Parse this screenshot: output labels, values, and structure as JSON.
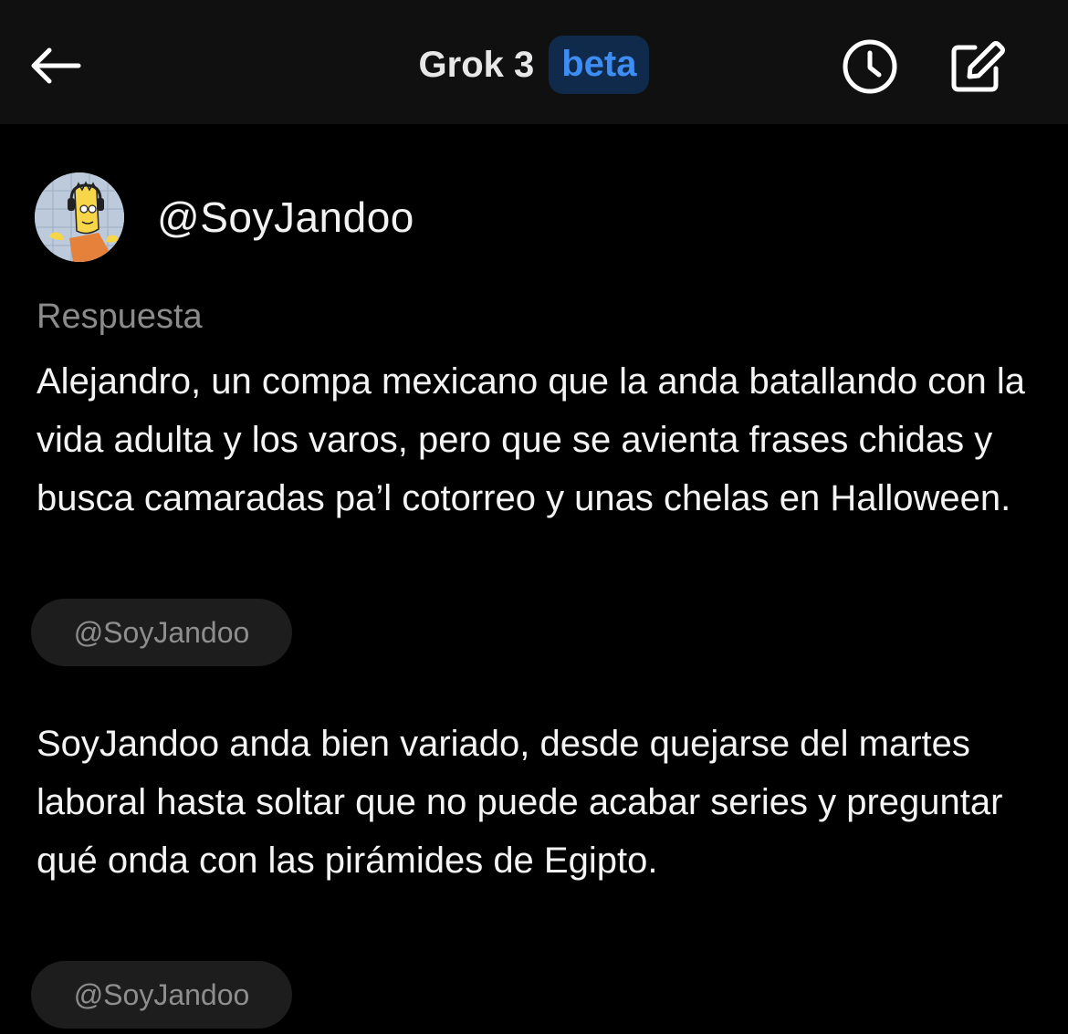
{
  "header": {
    "title": "Grok 3",
    "badge": "beta"
  },
  "profile": {
    "handle": "@SoyJandoo"
  },
  "response": {
    "label": "Respuesta",
    "paragraphs": [
      {
        "text": "Alejandro, un compa mexicano que la anda batallando con la vida adulta y los varos, pero que se avienta frases chidas y busca camaradas pa’l cotorreo y unas chelas en Halloween.",
        "source_chip": "@SoyJandoo"
      },
      {
        "text": "SoyJandoo anda bien variado, desde quejarse del martes laboral hasta soltar que no puede acabar series y preguntar qué onda con las pirámides de Egipto.",
        "source_chip": "@SoyJandoo"
      }
    ]
  },
  "colors": {
    "background": "#000000",
    "topbar": "#101010",
    "badge_bg": "#0f2a4a",
    "badge_text": "#3d8df5",
    "muted_text": "#8b8b8b",
    "chip_bg": "#1d1d1d"
  },
  "icons": {
    "back": "arrow-left-icon",
    "history": "clock-icon",
    "new_chat": "edit-icon"
  }
}
